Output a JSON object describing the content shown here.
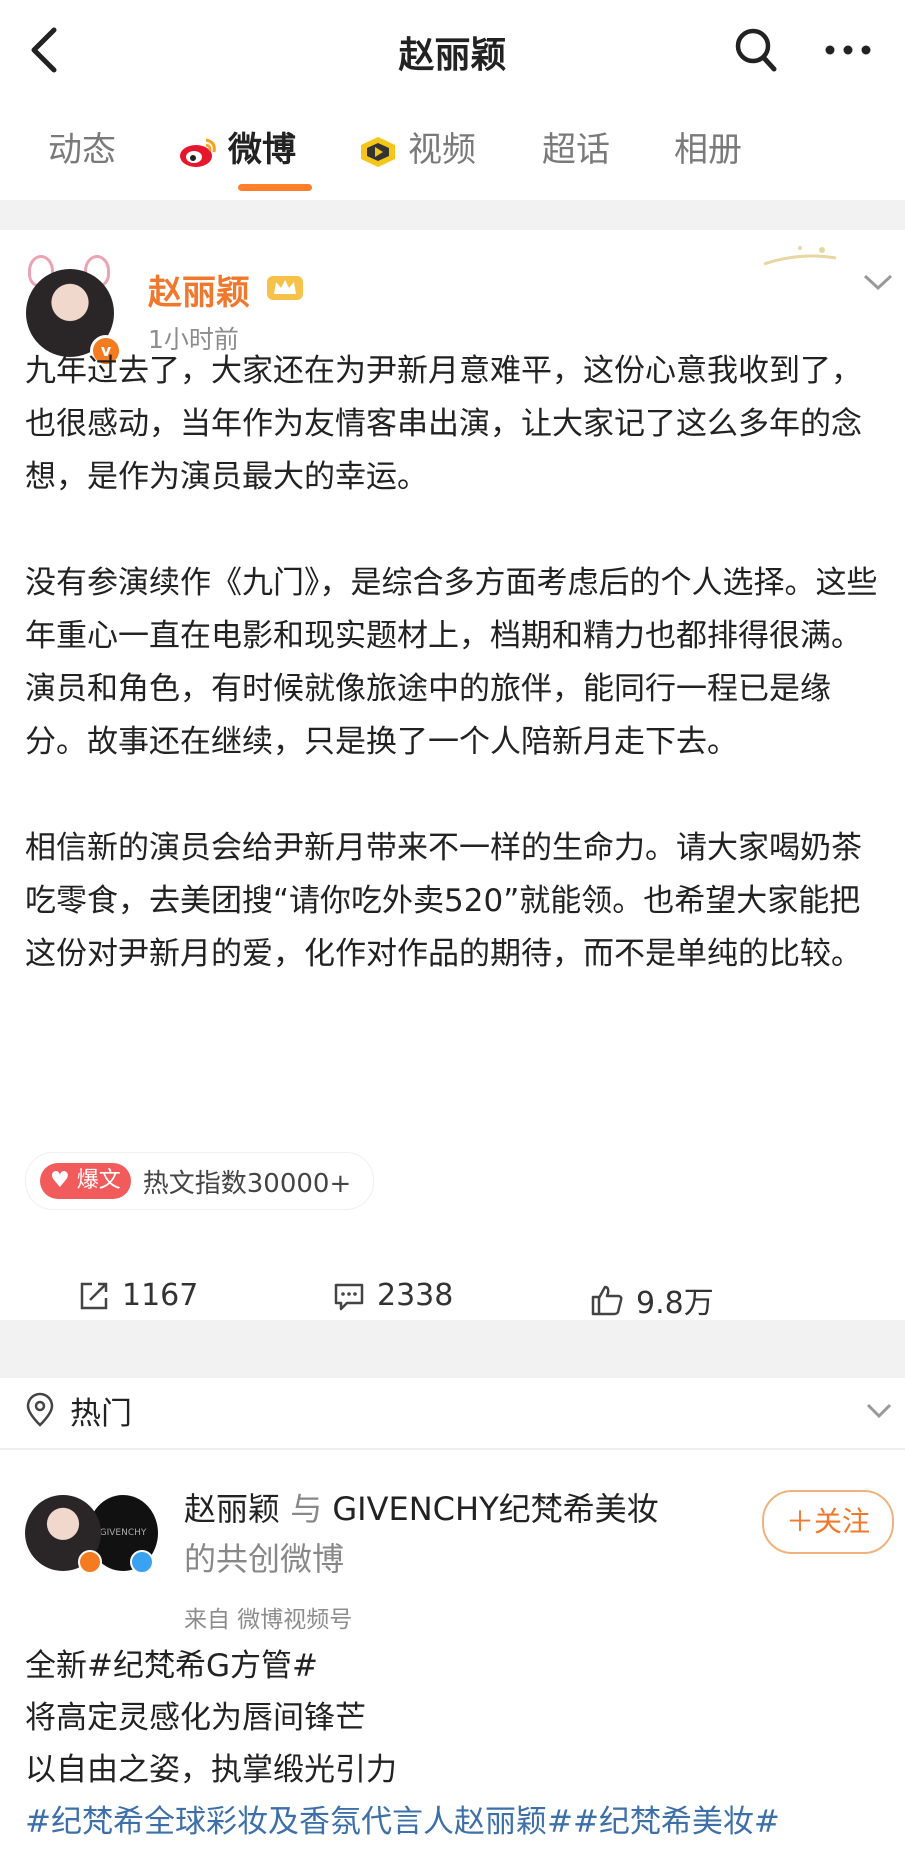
{
  "header": {
    "title": "赵丽颖",
    "back_icon": "back-arrow-icon",
    "search_icon": "search-icon",
    "more_icon": "more-dots-icon"
  },
  "tabs": [
    {
      "label": "动态",
      "active": false
    },
    {
      "label": "微博",
      "active": true,
      "icon": "weibo-logo-icon"
    },
    {
      "label": "视频",
      "active": false,
      "icon": "video-icon"
    },
    {
      "label": "超话",
      "active": false
    },
    {
      "label": "相册",
      "active": false
    }
  ],
  "accent_color": "#ff7f2a",
  "post": {
    "author": "赵丽颖",
    "time": "1小时前",
    "paragraphs": [
      "九年过去了，大家还在为尹新月意难平，这份心意我收到了，也很感动，当年作为友情客串出演，让大家记了这么多年的念想，是作为演员最大的幸运。",
      "没有参演续作《九门》，是综合多方面考虑后的个人选择。这些年重心一直在电影和现实题材上，档期和精力也都排得很满。演员和角色，有时候就像旅途中的旅伴，能同行一程已是缘分。故事还在继续，只是换了一个人陪新月走下去。",
      "相信新的演员会给尹新月带来不一样的生命力。请大家喝奶茶吃零食，去美团搜“请你吃外卖520”就能领。也希望大家能把这份对尹新月的爱，化作对作品的期待，而不是单纯的比较。"
    ],
    "hot_badge": "爆文",
    "hot_index": "热文指数30000+",
    "reposts": "1167",
    "comments": "2338",
    "likes": "9.8万"
  },
  "hot_section": {
    "label": "热门"
  },
  "post2": {
    "author": "赵丽颖",
    "connector": "与",
    "partner": "GIVENCHY纪梵希美妆",
    "co_note": "的共创微博",
    "source": "来自 微博视频号",
    "follow_label": "＋关注",
    "lines": [
      "全新#纪梵希G方管#",
      "将高定灵感化为唇间锋芒",
      "以自由之姿，执掌缎光引力"
    ],
    "tag_line": "#纪梵希全球彩妆及香氛代言人赵丽颖##纪梵希美妆#"
  }
}
